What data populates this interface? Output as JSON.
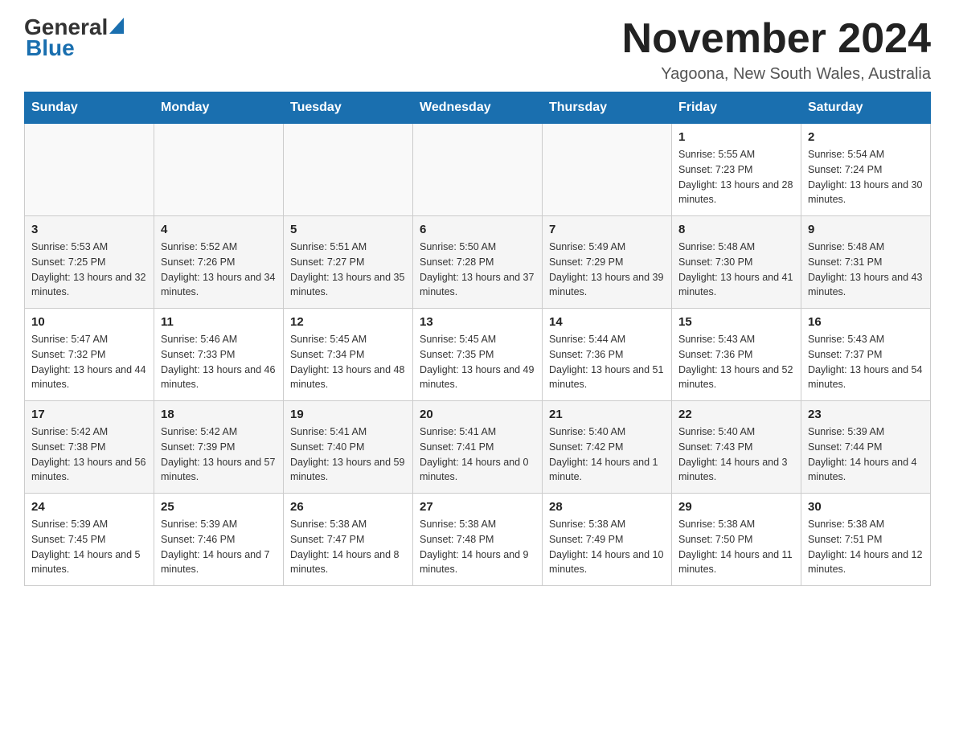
{
  "header": {
    "logo_general": "General",
    "logo_blue": "Blue",
    "month_title": "November 2024",
    "location": "Yagoona, New South Wales, Australia"
  },
  "weekdays": [
    "Sunday",
    "Monday",
    "Tuesday",
    "Wednesday",
    "Thursday",
    "Friday",
    "Saturday"
  ],
  "weeks": [
    [
      {
        "day": "",
        "info": ""
      },
      {
        "day": "",
        "info": ""
      },
      {
        "day": "",
        "info": ""
      },
      {
        "day": "",
        "info": ""
      },
      {
        "day": "",
        "info": ""
      },
      {
        "day": "1",
        "info": "Sunrise: 5:55 AM\nSunset: 7:23 PM\nDaylight: 13 hours and 28 minutes."
      },
      {
        "day": "2",
        "info": "Sunrise: 5:54 AM\nSunset: 7:24 PM\nDaylight: 13 hours and 30 minutes."
      }
    ],
    [
      {
        "day": "3",
        "info": "Sunrise: 5:53 AM\nSunset: 7:25 PM\nDaylight: 13 hours and 32 minutes."
      },
      {
        "day": "4",
        "info": "Sunrise: 5:52 AM\nSunset: 7:26 PM\nDaylight: 13 hours and 34 minutes."
      },
      {
        "day": "5",
        "info": "Sunrise: 5:51 AM\nSunset: 7:27 PM\nDaylight: 13 hours and 35 minutes."
      },
      {
        "day": "6",
        "info": "Sunrise: 5:50 AM\nSunset: 7:28 PM\nDaylight: 13 hours and 37 minutes."
      },
      {
        "day": "7",
        "info": "Sunrise: 5:49 AM\nSunset: 7:29 PM\nDaylight: 13 hours and 39 minutes."
      },
      {
        "day": "8",
        "info": "Sunrise: 5:48 AM\nSunset: 7:30 PM\nDaylight: 13 hours and 41 minutes."
      },
      {
        "day": "9",
        "info": "Sunrise: 5:48 AM\nSunset: 7:31 PM\nDaylight: 13 hours and 43 minutes."
      }
    ],
    [
      {
        "day": "10",
        "info": "Sunrise: 5:47 AM\nSunset: 7:32 PM\nDaylight: 13 hours and 44 minutes."
      },
      {
        "day": "11",
        "info": "Sunrise: 5:46 AM\nSunset: 7:33 PM\nDaylight: 13 hours and 46 minutes."
      },
      {
        "day": "12",
        "info": "Sunrise: 5:45 AM\nSunset: 7:34 PM\nDaylight: 13 hours and 48 minutes."
      },
      {
        "day": "13",
        "info": "Sunrise: 5:45 AM\nSunset: 7:35 PM\nDaylight: 13 hours and 49 minutes."
      },
      {
        "day": "14",
        "info": "Sunrise: 5:44 AM\nSunset: 7:36 PM\nDaylight: 13 hours and 51 minutes."
      },
      {
        "day": "15",
        "info": "Sunrise: 5:43 AM\nSunset: 7:36 PM\nDaylight: 13 hours and 52 minutes."
      },
      {
        "day": "16",
        "info": "Sunrise: 5:43 AM\nSunset: 7:37 PM\nDaylight: 13 hours and 54 minutes."
      }
    ],
    [
      {
        "day": "17",
        "info": "Sunrise: 5:42 AM\nSunset: 7:38 PM\nDaylight: 13 hours and 56 minutes."
      },
      {
        "day": "18",
        "info": "Sunrise: 5:42 AM\nSunset: 7:39 PM\nDaylight: 13 hours and 57 minutes."
      },
      {
        "day": "19",
        "info": "Sunrise: 5:41 AM\nSunset: 7:40 PM\nDaylight: 13 hours and 59 minutes."
      },
      {
        "day": "20",
        "info": "Sunrise: 5:41 AM\nSunset: 7:41 PM\nDaylight: 14 hours and 0 minutes."
      },
      {
        "day": "21",
        "info": "Sunrise: 5:40 AM\nSunset: 7:42 PM\nDaylight: 14 hours and 1 minute."
      },
      {
        "day": "22",
        "info": "Sunrise: 5:40 AM\nSunset: 7:43 PM\nDaylight: 14 hours and 3 minutes."
      },
      {
        "day": "23",
        "info": "Sunrise: 5:39 AM\nSunset: 7:44 PM\nDaylight: 14 hours and 4 minutes."
      }
    ],
    [
      {
        "day": "24",
        "info": "Sunrise: 5:39 AM\nSunset: 7:45 PM\nDaylight: 14 hours and 5 minutes."
      },
      {
        "day": "25",
        "info": "Sunrise: 5:39 AM\nSunset: 7:46 PM\nDaylight: 14 hours and 7 minutes."
      },
      {
        "day": "26",
        "info": "Sunrise: 5:38 AM\nSunset: 7:47 PM\nDaylight: 14 hours and 8 minutes."
      },
      {
        "day": "27",
        "info": "Sunrise: 5:38 AM\nSunset: 7:48 PM\nDaylight: 14 hours and 9 minutes."
      },
      {
        "day": "28",
        "info": "Sunrise: 5:38 AM\nSunset: 7:49 PM\nDaylight: 14 hours and 10 minutes."
      },
      {
        "day": "29",
        "info": "Sunrise: 5:38 AM\nSunset: 7:50 PM\nDaylight: 14 hours and 11 minutes."
      },
      {
        "day": "30",
        "info": "Sunrise: 5:38 AM\nSunset: 7:51 PM\nDaylight: 14 hours and 12 minutes."
      }
    ]
  ]
}
